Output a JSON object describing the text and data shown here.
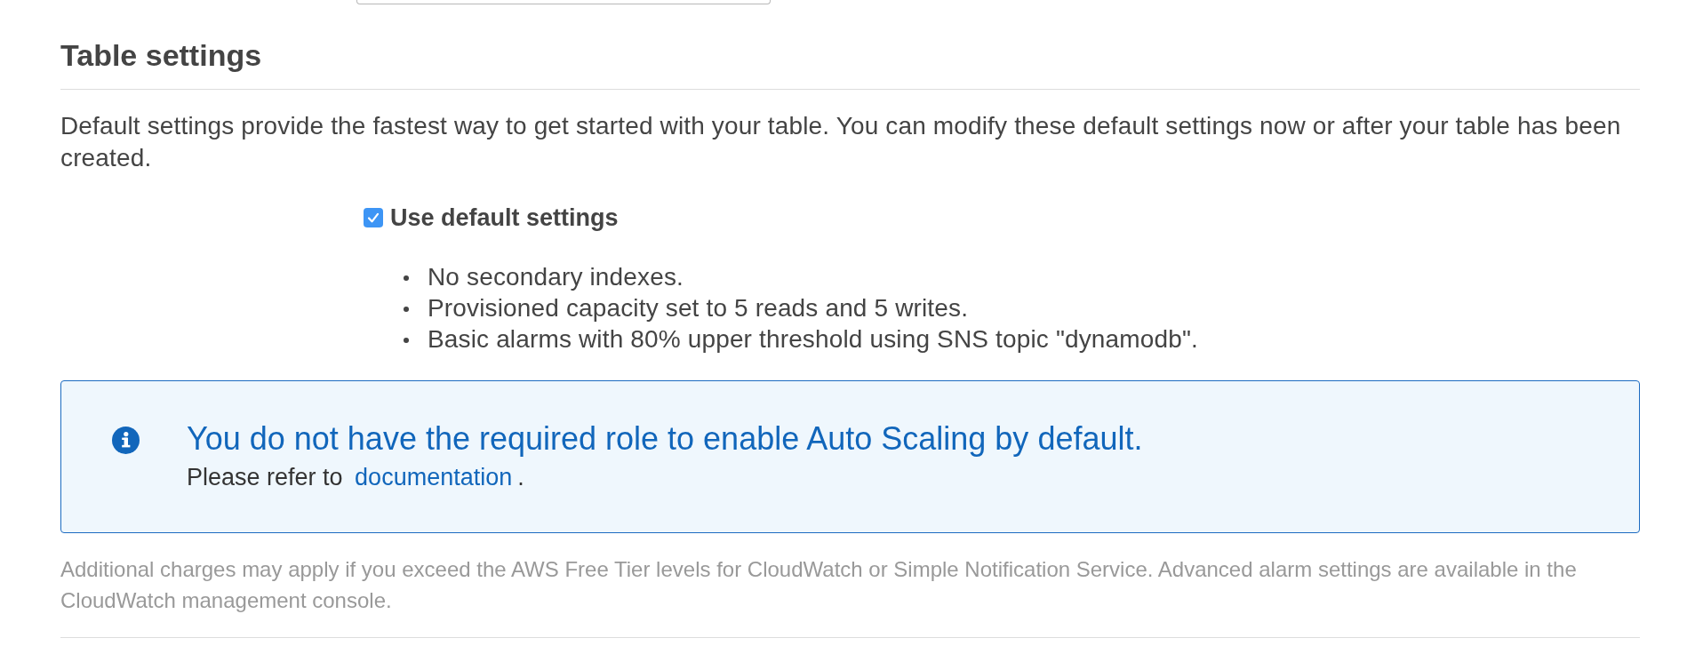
{
  "section": {
    "title": "Table settings",
    "description": "Default settings provide the fastest way to get started with your table. You can modify these default settings now or after your table has been created."
  },
  "default_settings": {
    "label": "Use default settings",
    "checked": true,
    "items": [
      "No secondary indexes.",
      "Provisioned capacity set to 5 reads and 5 writes.",
      "Basic alarms with 80% upper threshold using SNS topic \"dynamodb\"."
    ]
  },
  "info_alert": {
    "title": "You do not have the required role to enable Auto Scaling by default.",
    "text": "Please refer to",
    "link": "documentation",
    "suffix": "."
  },
  "footnote": "Additional charges may apply if you exceed the AWS Free Tier levels for CloudWatch or Simple Notification Service. Advanced alarm settings are available in the CloudWatch management console."
}
